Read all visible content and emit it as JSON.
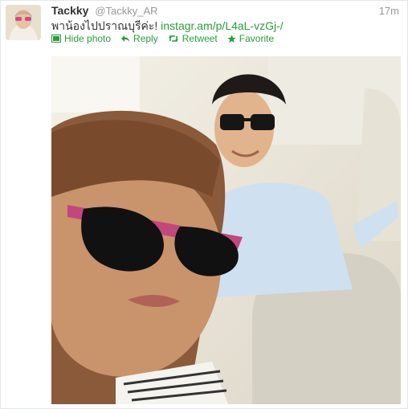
{
  "tweet": {
    "display_name": "Tackky",
    "handle": "@Tackky_AR",
    "time": "17m",
    "text": "พาน้องไปปราณบุรีค่ะ!",
    "link": "instagr.am/p/L4aL-vzGj-/"
  },
  "actions": {
    "hide_photo": "Hide photo",
    "reply": "Reply",
    "retweet": "Retweet",
    "favorite": "Favorite"
  },
  "icons": [
    "photo-icon",
    "reply-icon",
    "retweet-icon",
    "favorite-icon"
  ],
  "colors": {
    "link": "#2a9d3a",
    "name": "#333333",
    "meta": "#999999"
  }
}
